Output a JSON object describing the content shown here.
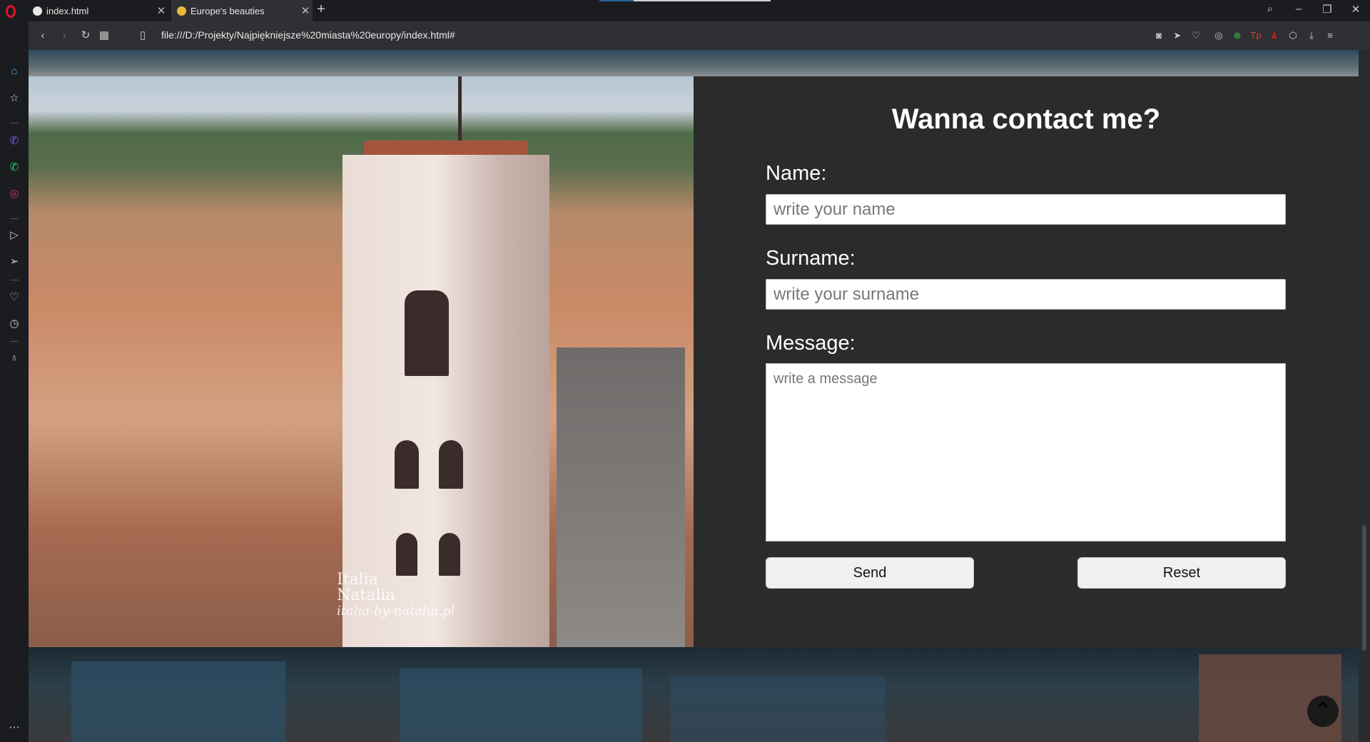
{
  "browser": {
    "tabs": [
      {
        "title": "index.html"
      },
      {
        "title": "Europe's beauties"
      }
    ],
    "url": "file:///D:/Projekty/Najpiękniejsze%20miasta%20europy/index.html#"
  },
  "photo": {
    "watermark_line1": "Italia",
    "watermark_line2": "Natalia",
    "watermark_line3": "italia-by-natalia.pl"
  },
  "contact_form": {
    "title": "Wanna contact me?",
    "name_label": "Name:",
    "name_placeholder": "write your name",
    "surname_label": "Surname:",
    "surname_placeholder": "write your surname",
    "message_label": "Message:",
    "message_placeholder": "write a message",
    "send_label": "Send",
    "reset_label": "Reset"
  }
}
